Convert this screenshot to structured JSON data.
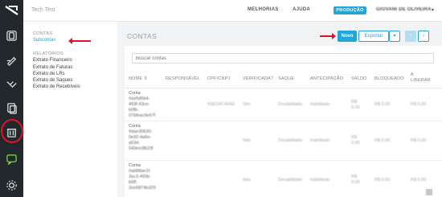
{
  "topbar": {
    "brand": "Tech Test",
    "nav": [
      "MELHORIAS",
      "AJUDA"
    ],
    "environment": "PRODUÇÃO",
    "user_name": "GIOVANI DE OLIVEIRA",
    "user_caret": "▾"
  },
  "submenu": {
    "section1_title": "CONTAS",
    "section1_items": [
      "Subcontas"
    ],
    "section2_title": "RELATÓRIOS",
    "section2_items": [
      "Extrato Financeiro",
      "Extrato de Faturas",
      "Extrato de LRs",
      "Extrato de Saques",
      "Extrato de Recebíveis"
    ]
  },
  "main": {
    "title": "CONTAS",
    "buttons": {
      "new": "Novo",
      "export": "Exportar",
      "caret": "▾",
      "prev": "‹",
      "next": "›"
    },
    "search_placeholder": "Buscar contas",
    "columns": [
      "NOME ⇕",
      "RESPONSÁVEL",
      "CPF/CNPJ",
      "VERIFICADA?",
      "SAQUE",
      "ANTECIPAÇÃO",
      "SALDO",
      "BLOQUEADO",
      "A LIBERAR"
    ],
    "rows": [
      {
        "name": [
          "Conta",
          "#ae5d5b4-",
          "493f-43ce-",
          "b0fb-",
          "07bfeac9e57f"
        ],
        "cpf": "43810474048",
        "verified": "Sim",
        "withdraw": "Desabilitado",
        "advance": "Habilitado",
        "balance": [
          "R$",
          "0,00"
        ],
        "blocked": "R$ 0,00",
        "release": "R$ 0,00"
      },
      {
        "name": [
          "Conta",
          "#dae30630-",
          "0e92-4a6e-",
          "a53d-",
          "540ee3fb23f"
        ],
        "cpf": "",
        "verified": "Não",
        "withdraw": "Desabilitado",
        "advance": "Habilitado",
        "balance": [
          "R$",
          "0,00"
        ],
        "blocked": "R$ 0,00",
        "release": "R$ 0,00"
      },
      {
        "name": [
          "Conta",
          "#ab88ae1f-",
          "3ac3-450b-",
          "b5ff-",
          "2ee9874b329"
        ],
        "cpf": "",
        "verified": "Não",
        "withdraw": "Desabilitado",
        "advance": "Habilitado",
        "balance": [
          "R$",
          "0,00"
        ],
        "blocked": "R$ 0,00",
        "release": "R$ 0,00"
      }
    ]
  },
  "colors": {
    "accent": "#21a6d9",
    "rail": "#23282d",
    "annotation": "#e3112a"
  }
}
